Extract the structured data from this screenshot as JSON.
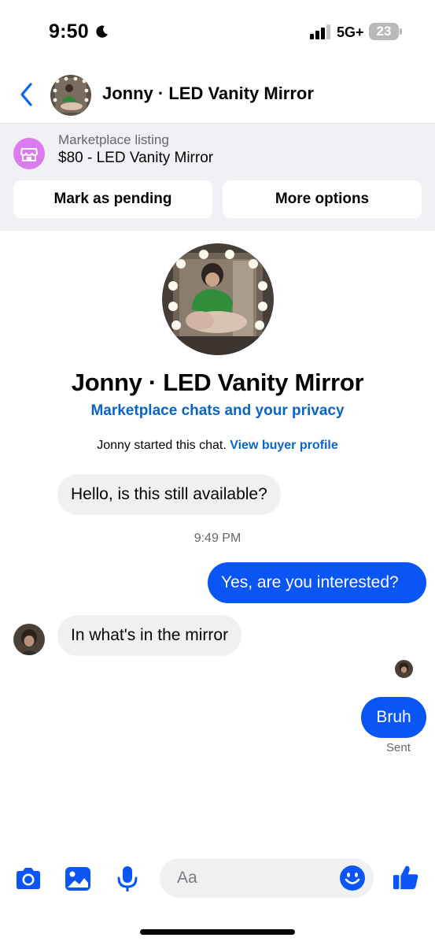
{
  "status_bar": {
    "time": "9:50",
    "network": "5G+",
    "battery": "23",
    "icons": [
      "moon-icon",
      "signal-icon",
      "battery-icon"
    ]
  },
  "header": {
    "title": "Jonny · LED Vanity Mirror",
    "back_icon": "chevron-left-icon"
  },
  "listing": {
    "kicker": "Marketplace listing",
    "title": "$80 - LED Vanity Mirror",
    "mark_pending_label": "Mark as pending",
    "more_options_label": "More options",
    "icon": "storefront-icon",
    "icon_color": "#dc7bf0"
  },
  "profile": {
    "name": "Jonny · LED Vanity Mirror",
    "privacy_link": "Marketplace chats and your privacy",
    "started_text": "Jonny started this chat.",
    "buyer_link": "View buyer profile"
  },
  "messages": [
    {
      "text": "Hello, is this still available?",
      "direction": "incoming"
    },
    {
      "text": "Yes, are you interested?",
      "direction": "outgoing"
    },
    {
      "text": "In what's in the mirror",
      "direction": "incoming"
    },
    {
      "text": "Bruh",
      "direction": "outgoing"
    }
  ],
  "timestamp": "9:49 PM",
  "sent_status": "Sent",
  "composer": {
    "placeholder": "Aa",
    "icons": [
      "camera-icon",
      "gallery-icon",
      "microphone-icon",
      "emoji-icon",
      "thumbs-up-icon"
    ]
  },
  "colors": {
    "accent": "#0a55f5",
    "link": "#0a64c8",
    "incoming_bubble": "#f0f0f2",
    "listing_panel": "#f0f1f4"
  }
}
